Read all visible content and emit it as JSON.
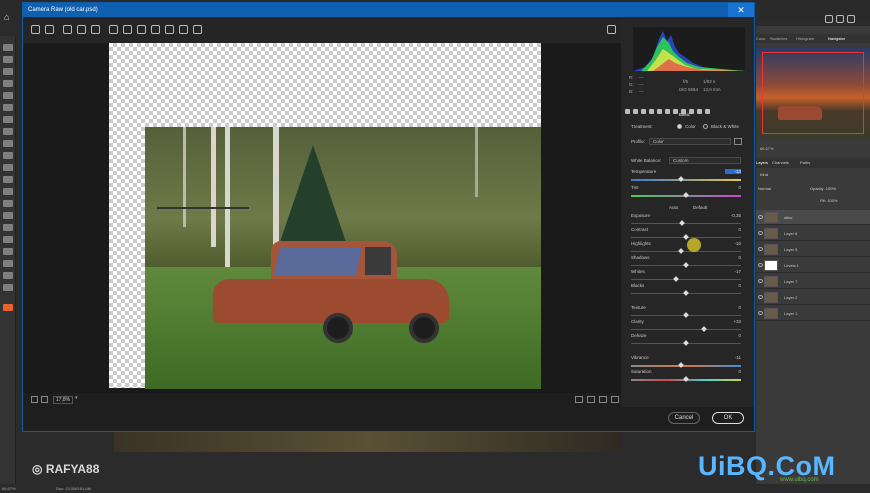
{
  "photoshop": {
    "document_tab": "file",
    "statusbar": {
      "zoom": "66,67%",
      "doc": "Doc: 13,0M/181,6M"
    },
    "navigator": {
      "tabs": [
        "Color",
        "Swatches",
        "Histogram",
        "Navigator"
      ],
      "zoom": "66,67%"
    },
    "layers": {
      "tabs": [
        "Layers",
        "Channels",
        "Paths"
      ],
      "filter": "Kind",
      "blend_mode": "Normal",
      "opacity": "Opacity: 100%",
      "fill": "Fill: 100%",
      "items": [
        {
          "name": "sblur",
          "selected": true
        },
        {
          "name": "Layer 6"
        },
        {
          "name": "Layer 5"
        },
        {
          "name": "Levels 1"
        },
        {
          "name": "Layer 7"
        },
        {
          "name": "Layer 2"
        },
        {
          "name": "Layer 1"
        }
      ]
    }
  },
  "camera_raw": {
    "title": "Camera Raw (old car.psd)",
    "close_label": "✕",
    "zoom": "17,8%",
    "histogram_info": {
      "r_label": "R:",
      "g_label": "G:",
      "b_label": "B:",
      "r": "---",
      "g": "---",
      "b": "---",
      "aperture": "f/5",
      "shutter": "1/83 s",
      "iso": "ISO 5664",
      "focal": "13,6 mm"
    },
    "section": "Basic",
    "treatment_label": "Treatment:",
    "treatment_color": "Color",
    "treatment_bw": "Black & White",
    "profile_label": "Profile:",
    "profile_value": "Color",
    "wb_label": "White Balance:",
    "wb_value": "Custom",
    "auto_label": "Auto",
    "default_label": "Default",
    "sliders": [
      {
        "id": "temperature",
        "label": "Temperature",
        "value": "-13",
        "pos": 0.45,
        "style": "temp"
      },
      {
        "id": "tint",
        "label": "Tint",
        "value": "0",
        "pos": 0.5,
        "style": "tint"
      },
      {
        "id": "exposure",
        "label": "Exposure",
        "value": "-0,35",
        "pos": 0.46,
        "style": ""
      },
      {
        "id": "contrast",
        "label": "Contrast",
        "value": "0",
        "pos": 0.5,
        "style": ""
      },
      {
        "id": "highlights",
        "label": "Highlights",
        "value": "-10",
        "pos": 0.45,
        "style": ""
      },
      {
        "id": "shadows",
        "label": "Shadows",
        "value": "0",
        "pos": 0.5,
        "style": ""
      },
      {
        "id": "whites",
        "label": "Whites",
        "value": "-17",
        "pos": 0.41,
        "style": ""
      },
      {
        "id": "blacks",
        "label": "Blacks",
        "value": "0",
        "pos": 0.5,
        "style": ""
      },
      {
        "id": "texture",
        "label": "Texture",
        "value": "0",
        "pos": 0.5,
        "style": ""
      },
      {
        "id": "clarity",
        "label": "Clarity",
        "value": "+33",
        "pos": 0.66,
        "style": ""
      },
      {
        "id": "dehaze",
        "label": "Dehaze",
        "value": "0",
        "pos": 0.5,
        "style": ""
      },
      {
        "id": "vibrance",
        "label": "Vibrance",
        "value": "-11",
        "pos": 0.45,
        "style": "vib"
      },
      {
        "id": "saturation",
        "label": "Saturation",
        "value": "0",
        "pos": 0.5,
        "style": "sat"
      }
    ],
    "cancel_label": "Cancel",
    "ok_label": "OK"
  },
  "watermarks": {
    "left": "RAFYA88",
    "right": "UiBQ.CoM",
    "sub": "www.uibq.com"
  },
  "colors": {
    "title_bar": "#0f60b0",
    "accent_watermark": "#5ab6ff",
    "selection_outline": "#e33333"
  }
}
